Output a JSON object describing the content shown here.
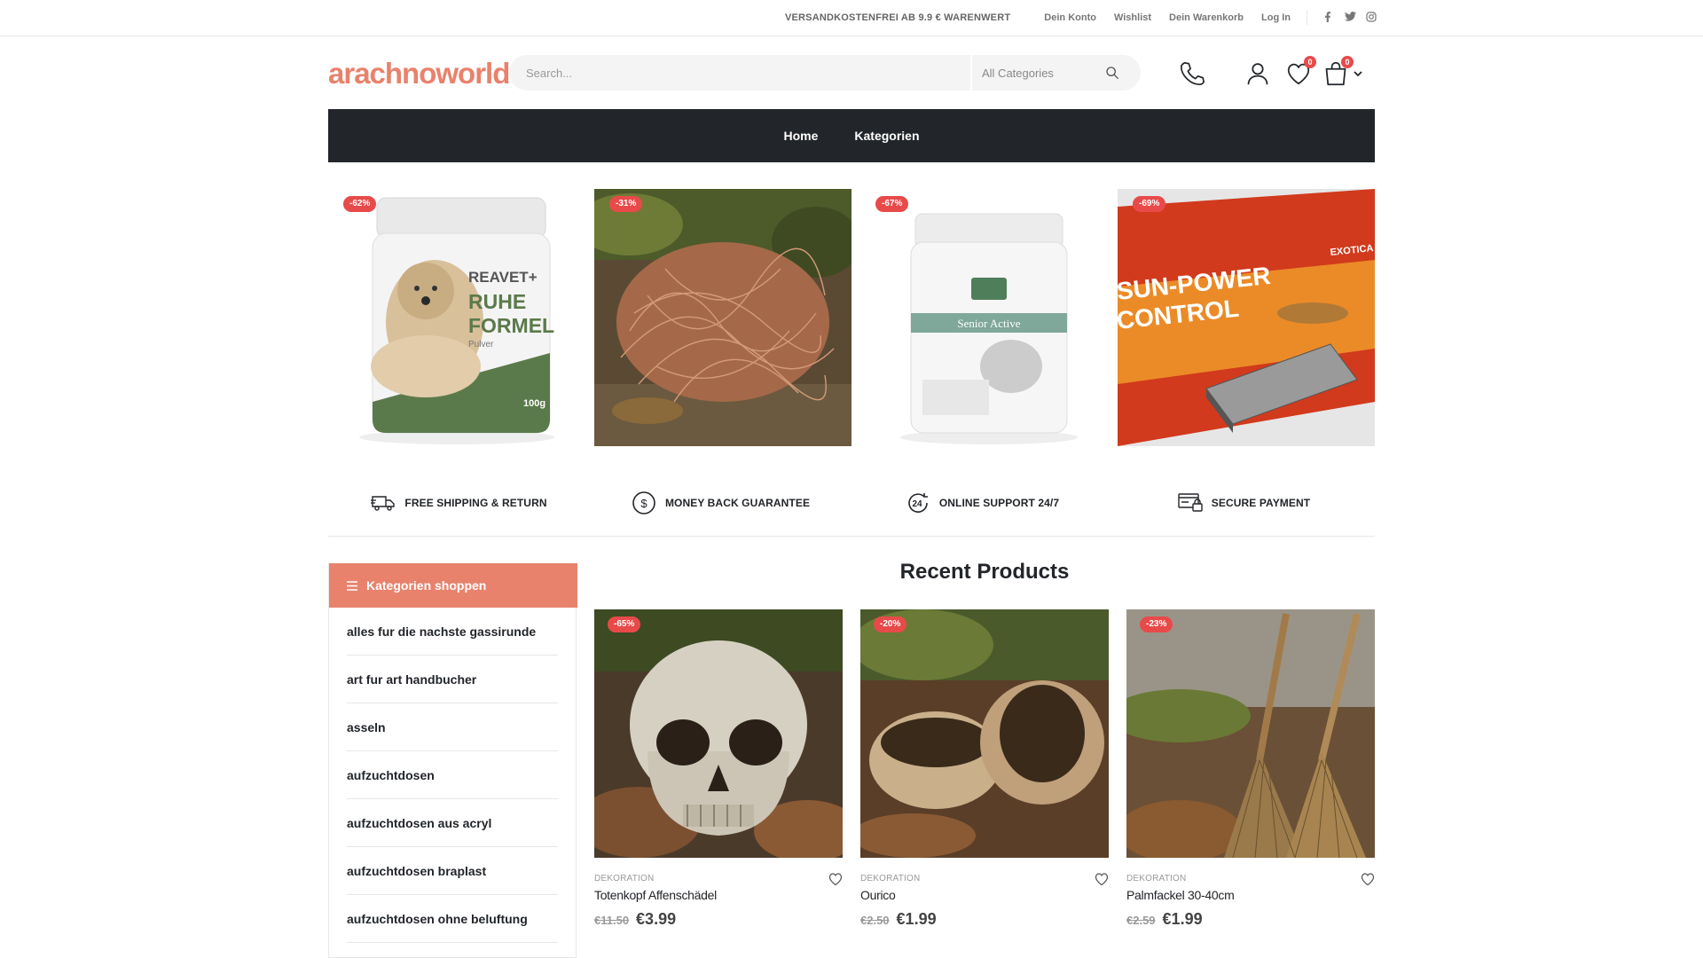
{
  "topbar": {
    "promo": "VERSANDKOSTENFREI AB 9.9 € WARENWERT",
    "links": [
      "Dein Konto",
      "Wishlist",
      "Dein Warenkorb",
      "Log In"
    ]
  },
  "header": {
    "logo": "arachnoworld",
    "search_placeholder": "Search...",
    "category_select": "All Categories",
    "wishlist_count": "0",
    "cart_count": "0"
  },
  "nav": {
    "items": [
      "Home",
      "Kategorien"
    ]
  },
  "banners": [
    {
      "discount": "-62%",
      "product_text": "REAVET RUHE FORMEL",
      "image_label": "Pulver",
      "weight": "100g"
    },
    {
      "discount": "-31%"
    },
    {
      "discount": "-67%",
      "product_text": "Senior Active"
    },
    {
      "discount": "-69%",
      "product_text": "SUN-POWER CONTROL",
      "image_label": "TERRA EXOTICA"
    }
  ],
  "features": [
    {
      "icon": "truck-icon",
      "label": "FREE SHIPPING & RETURN"
    },
    {
      "icon": "dollar-circle-icon",
      "label": "MONEY BACK GUARANTEE"
    },
    {
      "icon": "support-24-icon",
      "label": "ONLINE SUPPORT 24/7"
    },
    {
      "icon": "secure-card-icon",
      "label": "SECURE PAYMENT"
    }
  ],
  "sidebar": {
    "title": "Kategorien shoppen",
    "items": [
      "alles fur die nachste gassirunde",
      "art fur art handbucher",
      "asseln",
      "aufzuchtdosen",
      "aufzuchtdosen aus acryl",
      "aufzuchtdosen braplast",
      "aufzuchtdosen ohne beluftung"
    ]
  },
  "recent": {
    "title": "Recent Products",
    "products": [
      {
        "discount": "-65%",
        "category": "DEKORATION",
        "name": "Totenkopf Affenschädel",
        "old_price": "€11.50",
        "new_price": "€3.99"
      },
      {
        "discount": "-20%",
        "category": "DEKORATION",
        "name": "Ourico",
        "old_price": "€2.50",
        "new_price": "€1.99"
      },
      {
        "discount": "-23%",
        "category": "DEKORATION",
        "name": "Palmfackel 30-40cm",
        "old_price": "€2.59",
        "new_price": "€1.99"
      }
    ]
  },
  "colors": {
    "accent": "#e8826c",
    "dark": "#222529",
    "sale": "#e84a4a"
  }
}
